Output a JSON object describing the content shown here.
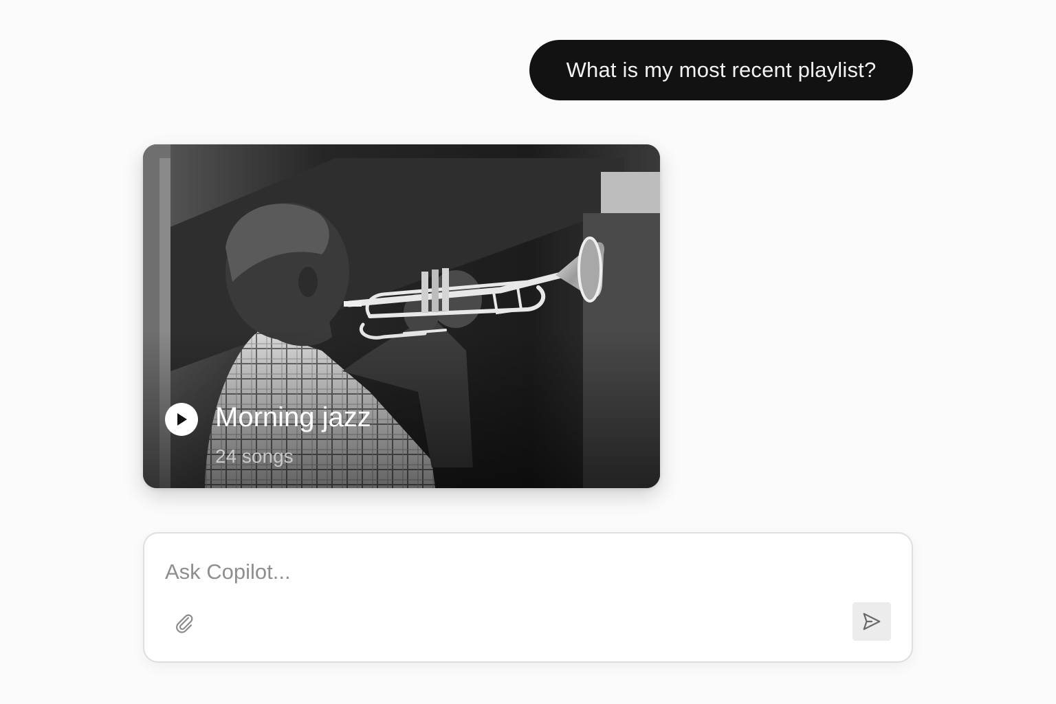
{
  "conversation": {
    "user_message": "What is my most recent playlist?"
  },
  "playlist_card": {
    "title": "Morning jazz",
    "song_count": "24 songs",
    "cover_description_icon": "trumpet-player-photo",
    "play_icon": "play-icon"
  },
  "composer": {
    "placeholder": "Ask Copilot...",
    "value": "",
    "attach_icon": "paperclip-icon",
    "send_icon": "send-icon"
  },
  "colors": {
    "page_background": "#fbfbfb",
    "user_bubble": "#121212",
    "user_bubble_text": "#f3f3f3",
    "send_button_bg": "#ececec",
    "icon_gray": "#8a8a8a"
  }
}
